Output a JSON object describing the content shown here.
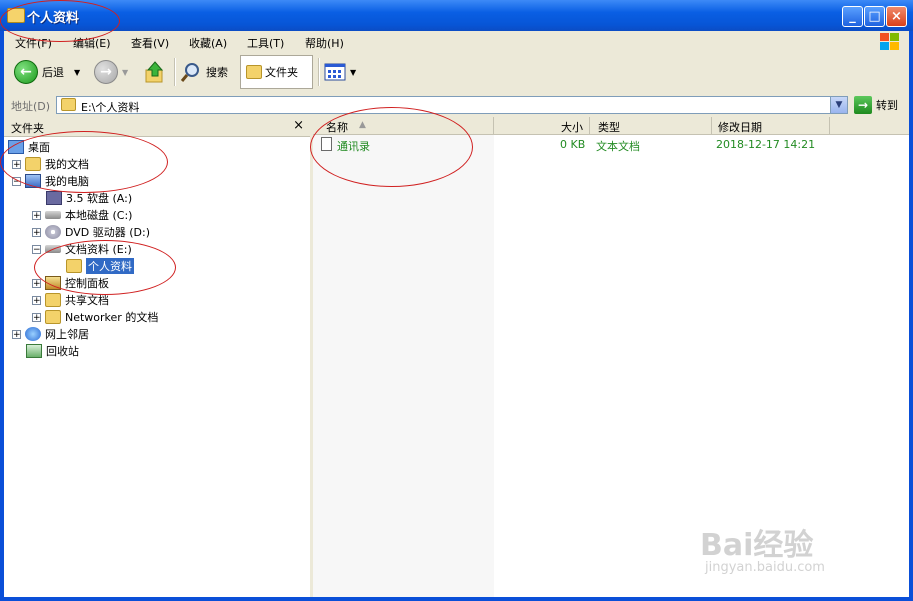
{
  "window": {
    "title": "个人资料"
  },
  "menu": [
    "文件(F)",
    "编辑(E)",
    "查看(V)",
    "收藏(A)",
    "工具(T)",
    "帮助(H)"
  ],
  "toolbar": {
    "back_label": "后退",
    "search_label": "搜索",
    "folders_label": "文件夹"
  },
  "address": {
    "label": "地址(D)",
    "value": "E:\\个人资料",
    "go_label": "转到"
  },
  "folders_pane": {
    "title": "文件夹",
    "close_glyph": "×"
  },
  "tree": [
    {
      "label": "桌面",
      "icon": "desktop-icon",
      "expander": ""
    },
    {
      "label": "我的文档",
      "icon": "my-documents-icon",
      "expander": "+"
    },
    {
      "label": "我的电脑",
      "icon": "my-computer-icon",
      "expander": "−"
    },
    {
      "label": "3.5 软盘 (A:)",
      "icon": "floppy-icon",
      "expander": ""
    },
    {
      "label": "本地磁盘 (C:)",
      "icon": "local-disk-icon",
      "expander": "+"
    },
    {
      "label": "DVD 驱动器 (D:)",
      "icon": "dvd-drive-icon",
      "expander": "+"
    },
    {
      "label": "文档资料 (E:)",
      "icon": "local-disk-icon",
      "expander": "−"
    },
    {
      "label": "个人资料",
      "icon": "folder-open-icon",
      "expander": ""
    },
    {
      "label": "控制面板",
      "icon": "control-panel-icon",
      "expander": "+"
    },
    {
      "label": "共享文档",
      "icon": "folder-icon",
      "expander": "+"
    },
    {
      "label": "Networker 的文档",
      "icon": "folder-icon",
      "expander": "+"
    },
    {
      "label": "网上邻居",
      "icon": "network-icon",
      "expander": "+"
    },
    {
      "label": "回收站",
      "icon": "recycle-bin-icon",
      "expander": ""
    }
  ],
  "columns": {
    "name": "名称",
    "size": "大小",
    "type": "类型",
    "modified": "修改日期"
  },
  "files": [
    {
      "name": "通讯录",
      "size": "0 KB",
      "type": "文本文档",
      "modified": "2018-12-17 14:21",
      "icon": "text-file-icon"
    }
  ],
  "watermark": {
    "brand": "Bai经验",
    "url": "jingyan.baidu.com"
  }
}
